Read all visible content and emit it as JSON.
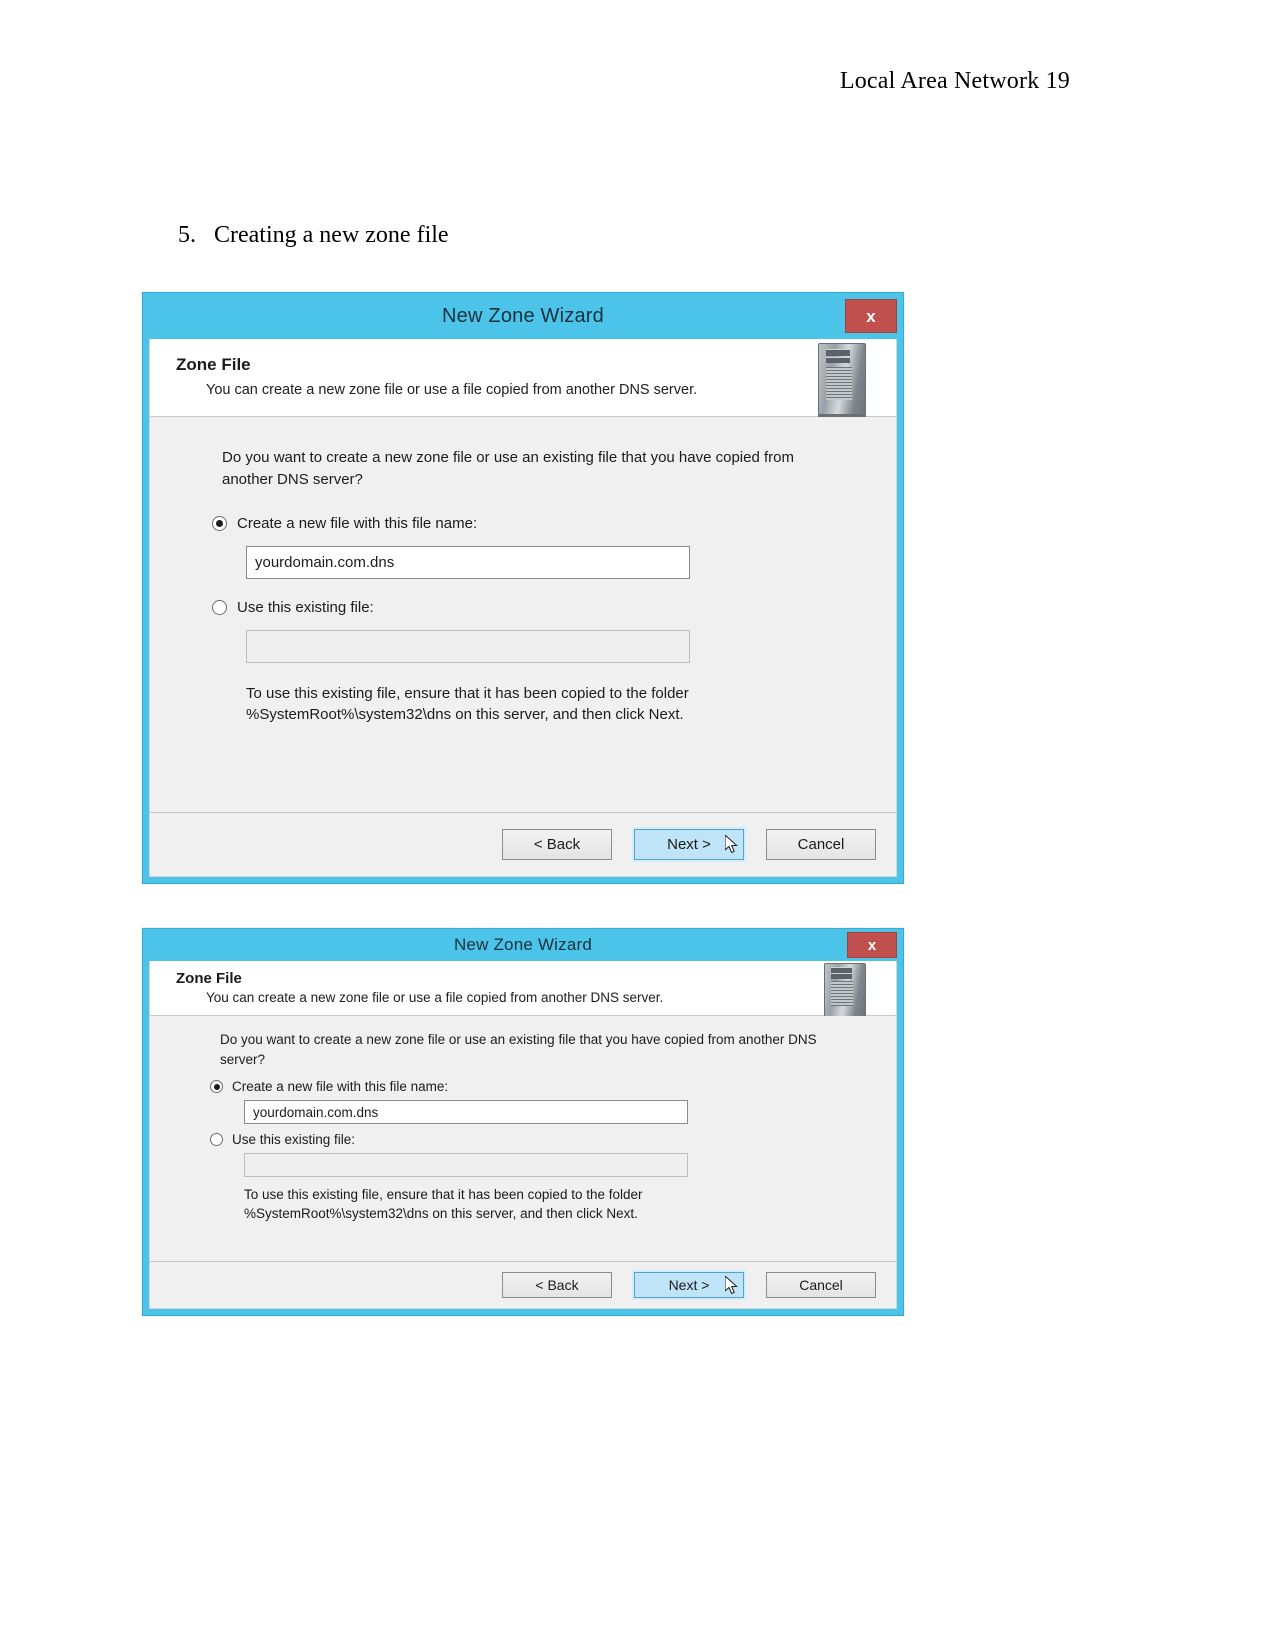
{
  "document": {
    "header": "Local Area Network 19",
    "step_number": "5.",
    "step_text": "Creating a new zone file"
  },
  "wizard": {
    "title": "New Zone Wizard",
    "close_label": "x",
    "banner": {
      "heading": "Zone File",
      "subtext": "You can create a new zone file or use a file copied from another DNS server.",
      "icon": "server-tower-icon"
    },
    "question": "Do you want to create a new zone file or use an existing file that you have copied from another DNS server?",
    "options": [
      {
        "label": "Create a new file with this file name:",
        "selected": true,
        "field_value": "yourdomain.com.dns",
        "field_enabled": true
      },
      {
        "label": "Use this existing file:",
        "selected": false,
        "field_value": "",
        "field_enabled": false
      }
    ],
    "hint_line_1": "To use this existing file, ensure that it has been copied to the folder",
    "hint_line_2": "%SystemRoot%\\system32\\dns on this server, and then click Next.",
    "buttons": {
      "back": "< Back",
      "next": "Next >",
      "cancel": "Cancel"
    },
    "colors": {
      "titlebar": "#4cc3e8",
      "close": "#c0504d",
      "focus": "#bfe4f7",
      "body": "#f0f0f0"
    }
  }
}
